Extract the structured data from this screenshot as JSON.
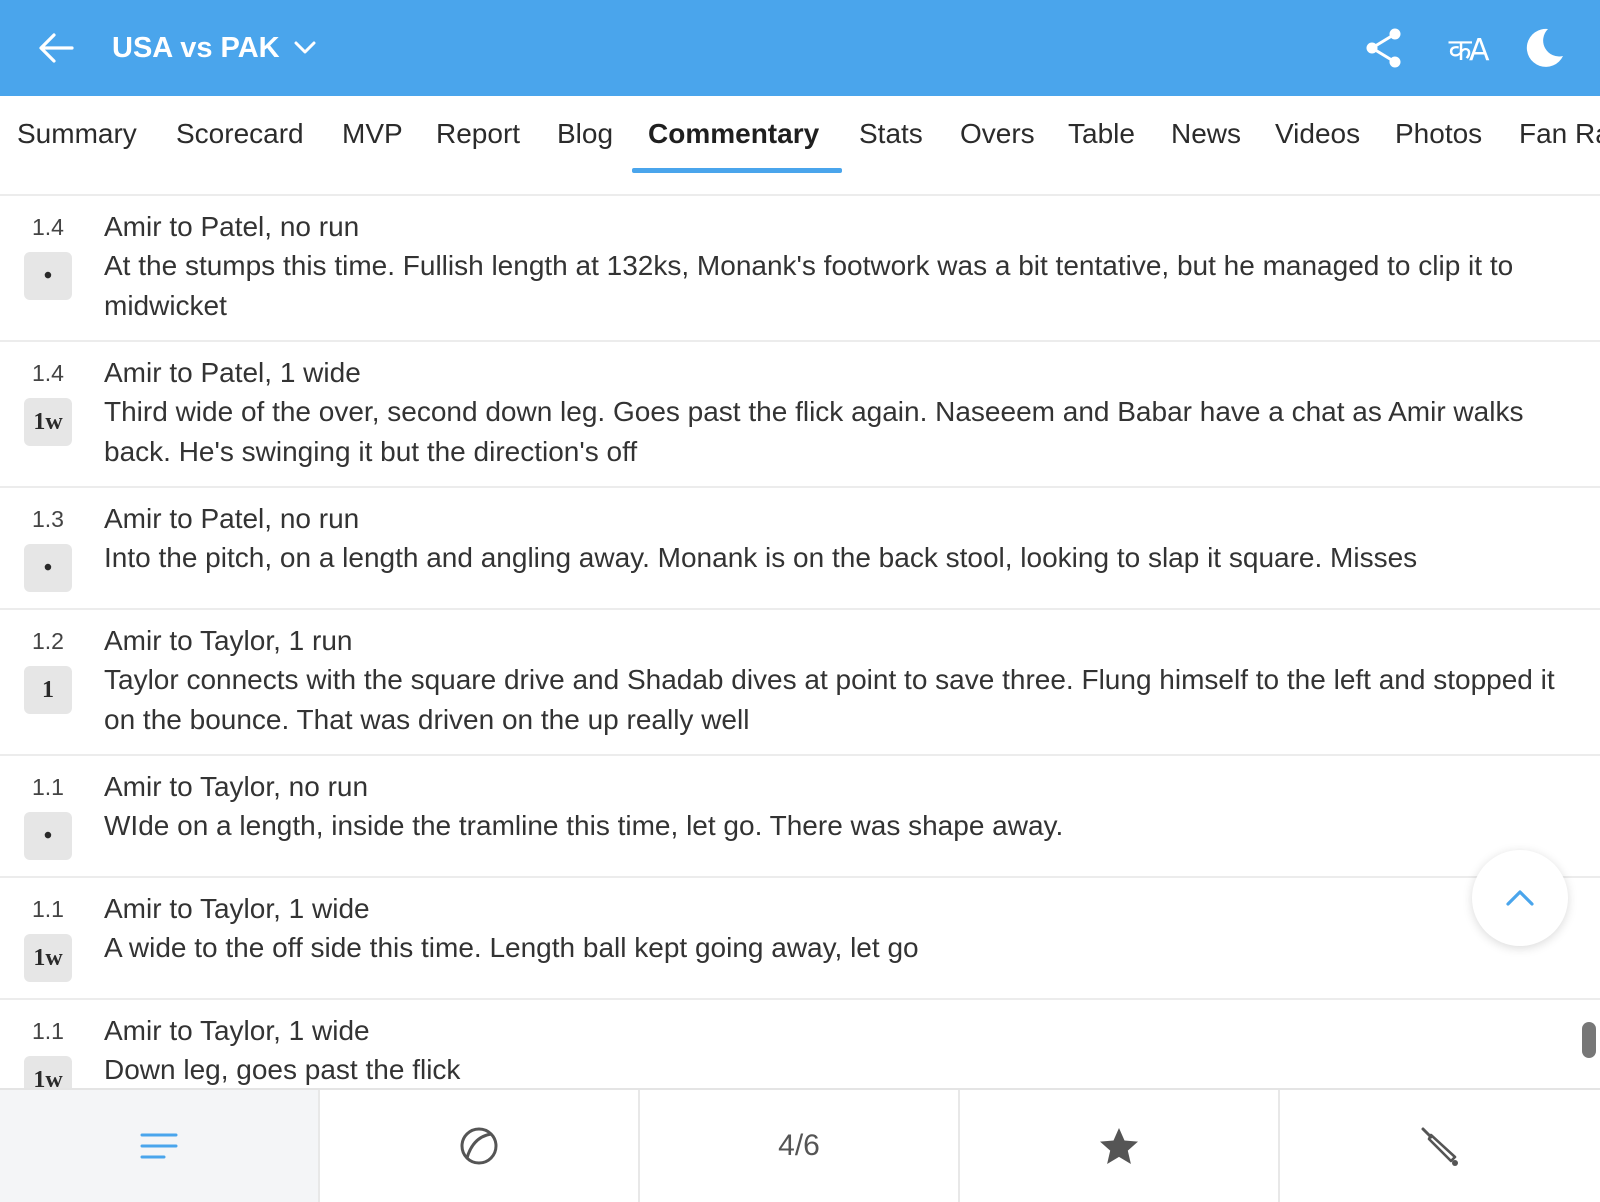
{
  "header": {
    "title": "USA vs PAK",
    "background_color": "#4aa5ec",
    "icons": {
      "back": "back-arrow-icon",
      "dropdown": "chevron-down-icon",
      "share": "share-icon",
      "language": "क A",
      "theme": "moon-icon"
    }
  },
  "tabs": [
    {
      "label": "Summary",
      "active": false
    },
    {
      "label": "Scorecard",
      "active": false
    },
    {
      "label": "MVP",
      "active": false
    },
    {
      "label": "Report",
      "active": false
    },
    {
      "label": "Blog",
      "active": false
    },
    {
      "label": "Commentary",
      "active": true
    },
    {
      "label": "Stats",
      "active": false
    },
    {
      "label": "Overs",
      "active": false
    },
    {
      "label": "Table",
      "active": false
    },
    {
      "label": "News",
      "active": false
    },
    {
      "label": "Videos",
      "active": false
    },
    {
      "label": "Photos",
      "active": false
    },
    {
      "label": "Fan Ra",
      "active": false
    }
  ],
  "commentary": [
    {
      "over": "1.4",
      "ball": "•",
      "title": "Amir to Patel, no run",
      "text": "At the stumps this time. Fullish length at 132ks, Monank's footwork was a bit tentative, but he managed to clip it to midwicket"
    },
    {
      "over": "1.4",
      "ball": "1w",
      "title": "Amir to Patel, 1 wide",
      "text": "Third wide of the over, second down leg. Goes past the flick again. Naseeem and Babar have a chat as Amir walks back. He's swinging it but the direction's off"
    },
    {
      "over": "1.3",
      "ball": "•",
      "title": "Amir to Patel, no run",
      "text": "Into the pitch, on a length and angling away. Monank is on the back stool, looking to slap it square. Misses"
    },
    {
      "over": "1.2",
      "ball": "1",
      "title": "Amir to Taylor, 1 run",
      "text": "Taylor connects with the square drive and Shadab dives at point to save three. Flung himself to the left and stopped it on the bounce. That was driven on the up really well"
    },
    {
      "over": "1.1",
      "ball": "•",
      "title": "Amir to Taylor, no run",
      "text": "WIde on a length, inside the tramline this time, let go. There was shape away."
    },
    {
      "over": "1.1",
      "ball": "1w",
      "title": "Amir to Taylor, 1 wide",
      "text": "A wide to the off side this time. Length ball kept going away, let go"
    },
    {
      "over": "1.1",
      "ball": "1w",
      "title": "Amir to Taylor, 1 wide",
      "text": "Down leg, goes past the flick"
    }
  ],
  "bottom_nav": {
    "items": [
      {
        "icon": "menu-lines-icon",
        "active": true
      },
      {
        "icon": "ball-icon",
        "active": false
      },
      {
        "text": "4/6",
        "active": false
      },
      {
        "icon": "star-icon",
        "active": false
      },
      {
        "icon": "cricket-bat-icon",
        "active": false
      }
    ]
  },
  "scroll_top": {
    "icon": "chevron-up-icon"
  },
  "colors": {
    "accent": "#4aa5ec",
    "badge_bg": "#e6e6e6",
    "divider": "#ececec"
  }
}
